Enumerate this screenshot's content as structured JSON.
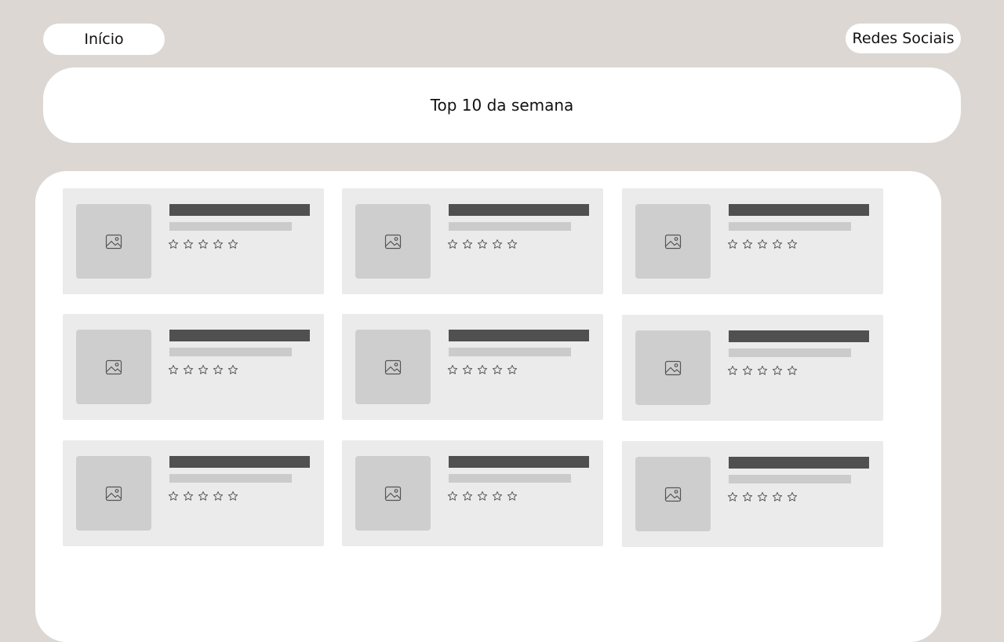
{
  "nav": {
    "home_label": "Início",
    "social_label": "Redes Sociais"
  },
  "header": {
    "title": "Top 10 da semana"
  },
  "products": {
    "cards": [
      {
        "image": "image-placeholder-icon",
        "rating": 0,
        "max_rating": 5
      },
      {
        "image": "image-placeholder-icon",
        "rating": 0,
        "max_rating": 5
      },
      {
        "image": "image-placeholder-icon",
        "rating": 0,
        "max_rating": 5
      },
      {
        "image": "image-placeholder-icon",
        "rating": 0,
        "max_rating": 5
      },
      {
        "image": "image-placeholder-icon",
        "rating": 0,
        "max_rating": 5
      },
      {
        "image": "image-placeholder-icon",
        "rating": 0,
        "max_rating": 5
      },
      {
        "image": "image-placeholder-icon",
        "rating": 0,
        "max_rating": 5
      },
      {
        "image": "image-placeholder-icon",
        "rating": 0,
        "max_rating": 5
      },
      {
        "image": "image-placeholder-icon",
        "rating": 0,
        "max_rating": 5
      }
    ]
  },
  "colors": {
    "background": "#dcd7d2",
    "panel": "#ffffff",
    "card": "#ebebeb",
    "placeholder": "#cecece",
    "title_bar": "#505050",
    "subtitle_bar": "#cbcbcb"
  }
}
